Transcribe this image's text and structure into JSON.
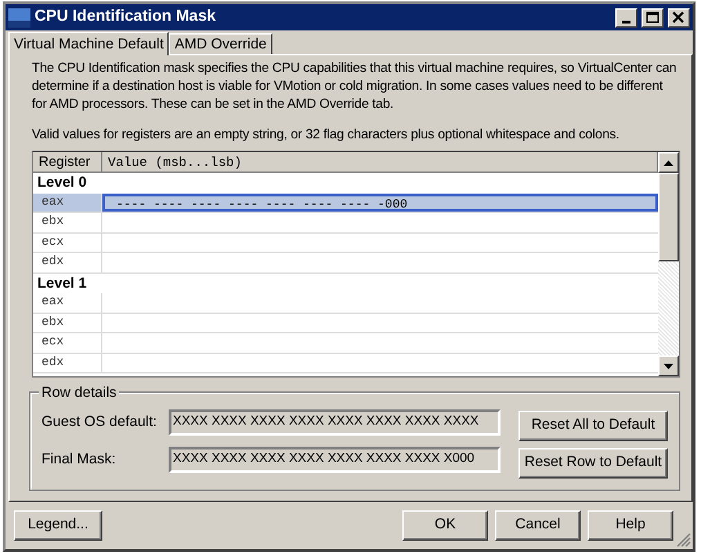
{
  "window": {
    "title": "CPU Identification Mask"
  },
  "tabs": [
    {
      "label": "Virtual Machine Default",
      "selected": true
    },
    {
      "label": "AMD Override",
      "selected": false
    }
  ],
  "description": [
    "The CPU Identification mask specifies the CPU capabilities that this virtual machine requires, so VirtualCenter can determine if a destination host is viable for VMotion or cold migration. In some cases values need to be different for AMD processors. These can be set in the AMD Override tab.",
    "Valid values for registers are an empty string, or 32 flag characters plus optional whitespace and colons."
  ],
  "table": {
    "columns": [
      "Register",
      "Value (msb...lsb)"
    ],
    "groups": [
      {
        "label": "Level 0",
        "rows": [
          {
            "register": "eax",
            "value": "---- ---- ---- ---- ---- ---- ---- -000",
            "selected": true
          },
          {
            "register": "ebx",
            "value": "",
            "selected": false
          },
          {
            "register": "ecx",
            "value": "",
            "selected": false
          },
          {
            "register": "edx",
            "value": "",
            "selected": false
          }
        ]
      },
      {
        "label": "Level 1",
        "rows": [
          {
            "register": "eax",
            "value": "",
            "selected": false
          },
          {
            "register": "ebx",
            "value": "",
            "selected": false
          },
          {
            "register": "ecx",
            "value": "",
            "selected": false
          },
          {
            "register": "edx",
            "value": "",
            "selected": false
          }
        ]
      }
    ]
  },
  "row_details": {
    "title": "Row details",
    "fields": [
      {
        "label": "Guest OS default:",
        "value": "XXXX XXXX XXXX XXXX XXXX XXXX XXXX XXXX"
      },
      {
        "label": "Final Mask:",
        "value": "XXXX XXXX XXXX XXXX XXXX XXXX XXXX X000"
      }
    ],
    "buttons": [
      "Reset All to Default",
      "Reset Row to Default"
    ]
  },
  "footer": {
    "left_buttons": [
      "Legend..."
    ],
    "right_buttons": [
      "OK",
      "Cancel",
      "Help"
    ]
  }
}
